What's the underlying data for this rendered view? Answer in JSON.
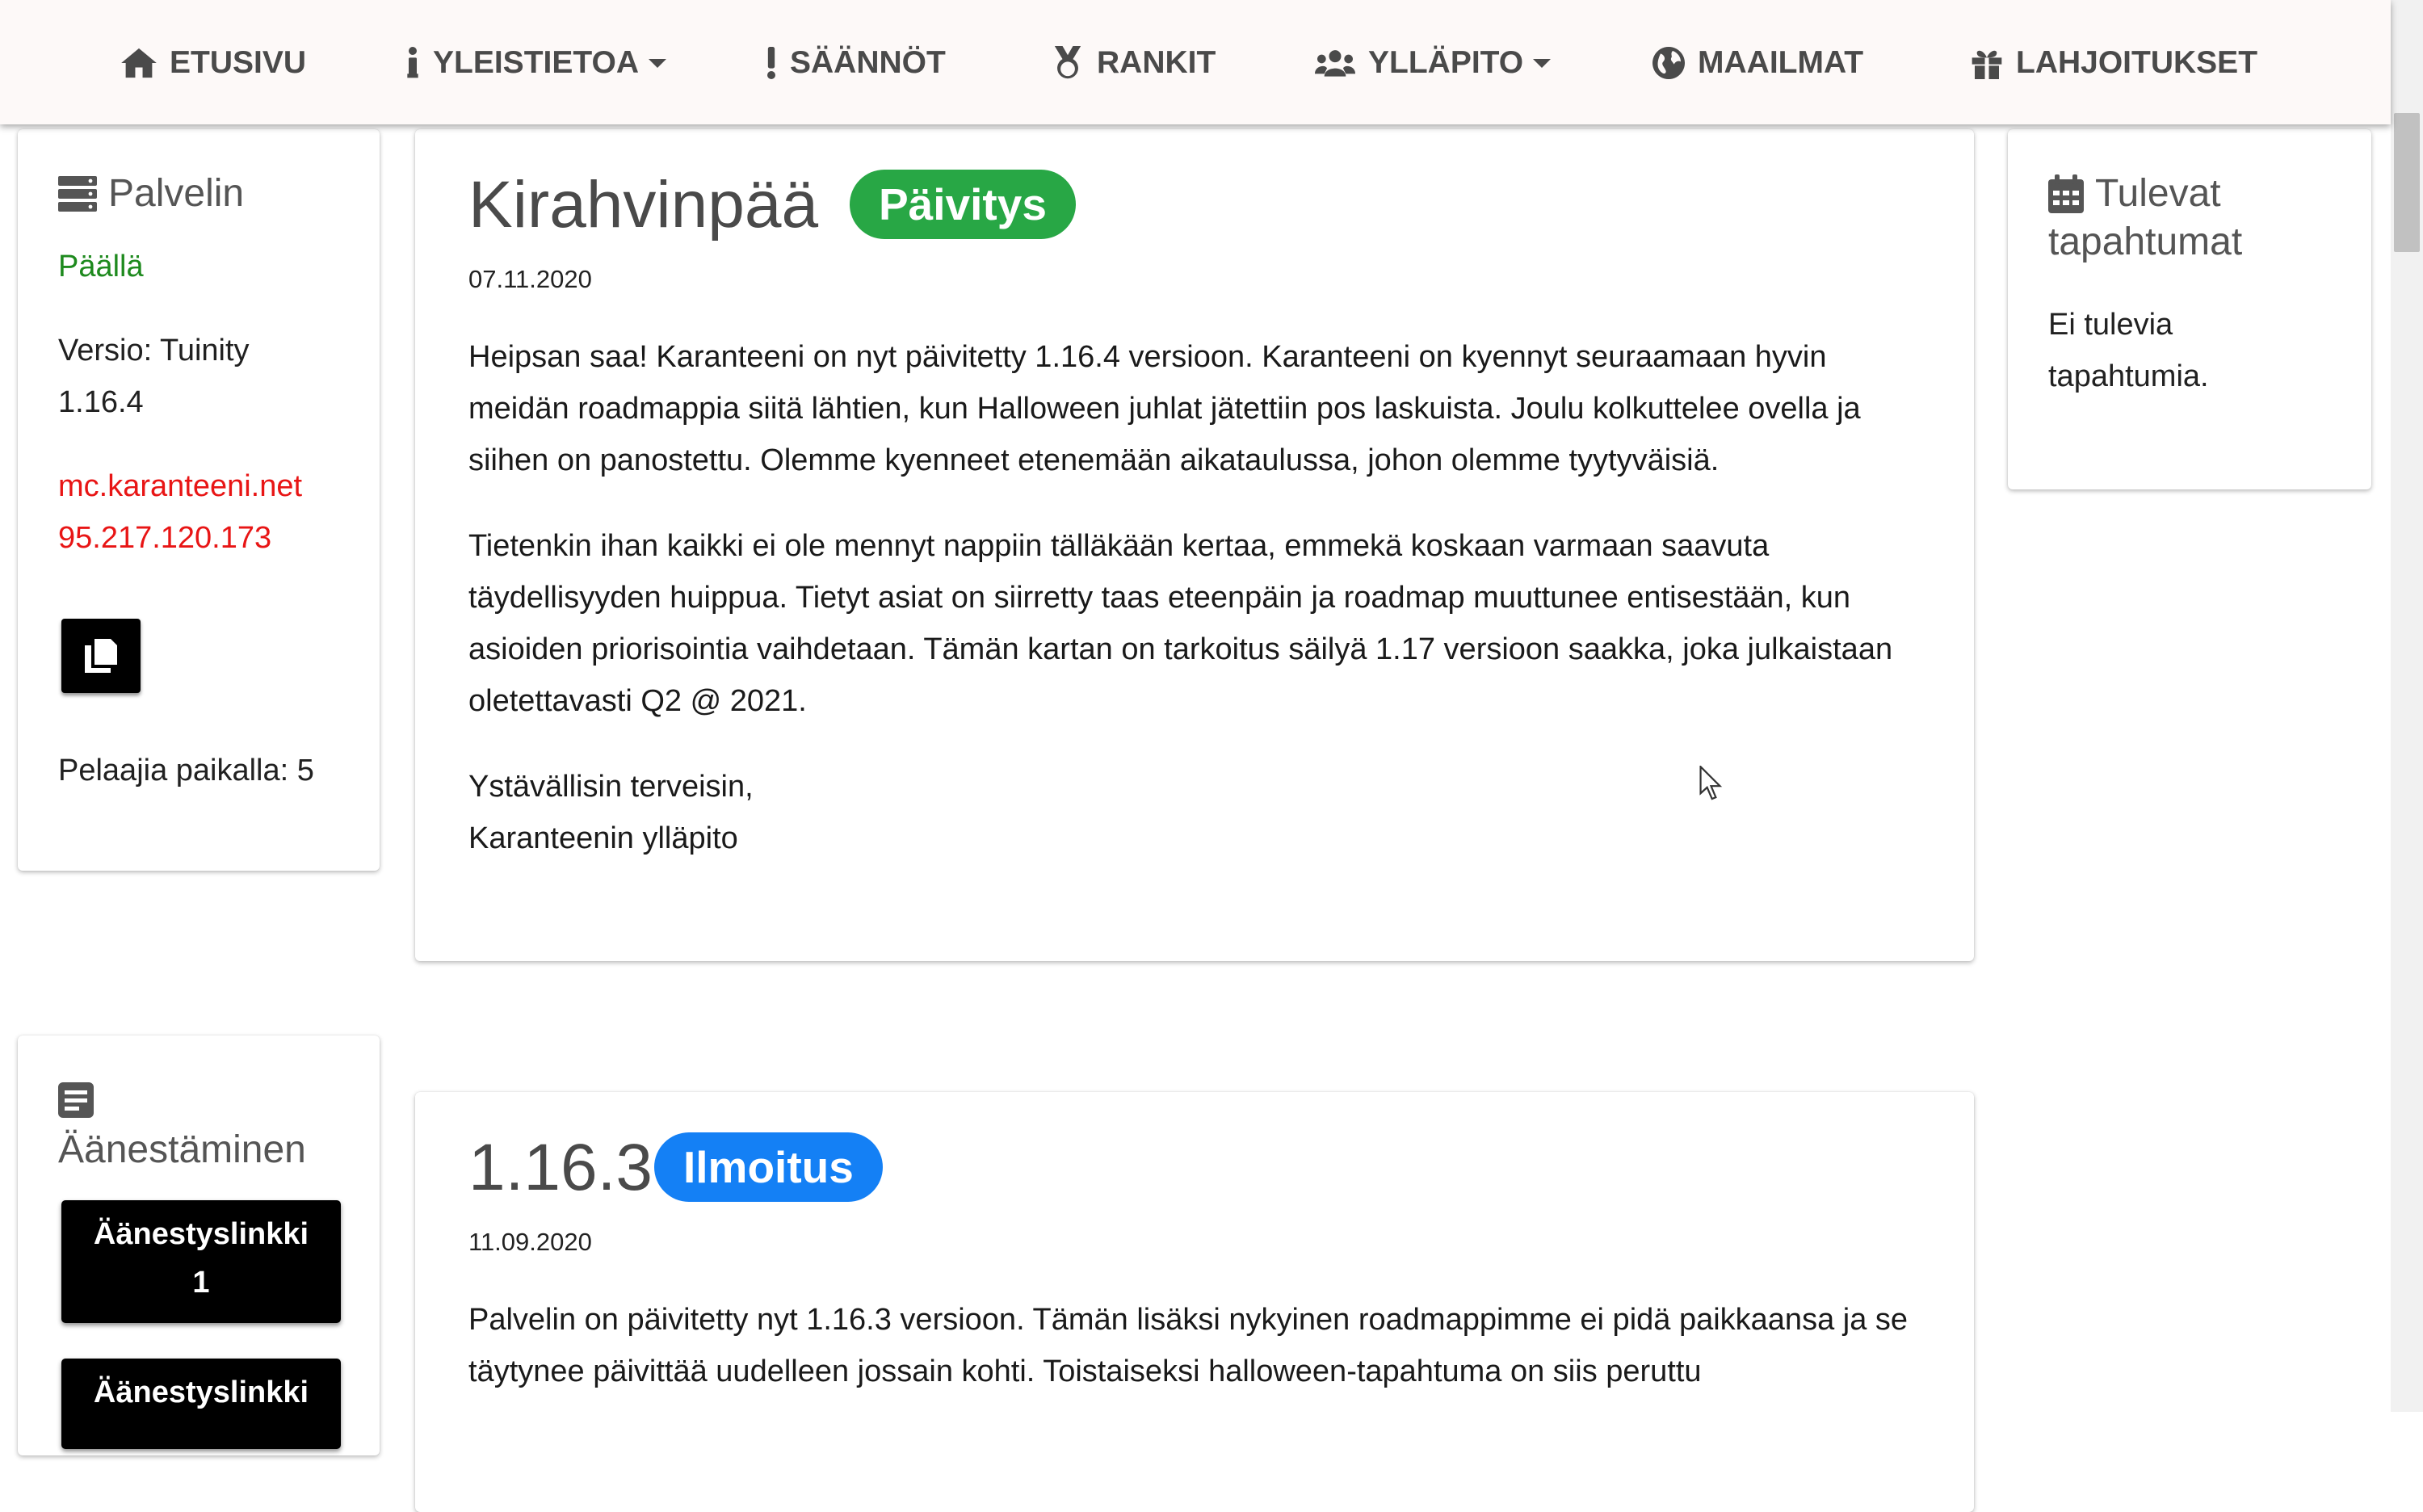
{
  "nav": {
    "home": "ETUSIVU",
    "info": "YLEISTIETOA",
    "rules": "SÄÄNNÖT",
    "ranks": "RANKIT",
    "staff": "YLLÄPITO",
    "worlds": "MAAILMAT",
    "donations": "LAHJOITUKSET"
  },
  "server": {
    "title": "Palvelin",
    "status": "Päällä",
    "version_line1": "Versio: Tuinity",
    "version_line2": "1.16.4",
    "address": "mc.karanteeni.net",
    "ip": "95.217.120.173",
    "players": "Pelaajia paikalla: 5"
  },
  "voting": {
    "title": "Äänestäminen",
    "link1_line1": "Äänestyslinkki",
    "link1_line2": "1",
    "link2_line1": "Äänestyslinkki"
  },
  "events": {
    "title_line1": "Tulevat",
    "title_line2": "tapahtumat",
    "empty_line1": "Ei tulevia",
    "empty_line2": "tapahtumia."
  },
  "posts": [
    {
      "title": "Kirahvinpää",
      "badge": "Päivitys",
      "date": "07.11.2020",
      "p1": "Heipsan saa! Karanteeni on nyt päivitetty 1.16.4 versioon. Karanteeni on kyennyt seuraamaan hyvin meidän roadmappia siitä lähtien, kun Halloween juhlat jätettiin pos laskuista. Joulu kolkuttelee ovella ja siihen on panostettu. Olemme kyenneet etenemään aikataulussa, johon olemme tyytyväisiä.",
      "p2": "Tietenkin ihan kaikki ei ole mennyt nappiin tälläkään kertaa, emmekä koskaan varmaan saavuta täydellisyyden huippua. Tietyt asiat on siirretty taas eteenpäin ja roadmap muuttunee entisestään, kun asioiden priorisointia vaihdetaan. Tämän kartan on tarkoitus säilyä 1.17 versioon saakka, joka julkaistaan oletettavasti Q2 @ 2021.",
      "sign1": "Ystävällisin terveisin,",
      "sign2": "Karanteenin ylläpito"
    },
    {
      "title": "1.16.3",
      "badge": "Ilmoitus",
      "date": "11.09.2020",
      "p1": "Palvelin on päivitetty nyt 1.16.3 versioon. Tämän lisäksi nykyinen roadmappimme ei pidä paikkaansa ja se täytynee päivittää uudelleen jossain kohti. Toistaiseksi halloween-tapahtuma on siis peruttu"
    }
  ],
  "colors": {
    "accent_green": "#28a745",
    "accent_blue": "#1480f5",
    "status_green": "#1e8a1e",
    "address_red": "#e81515",
    "nav_text": "#4a4a4a"
  }
}
